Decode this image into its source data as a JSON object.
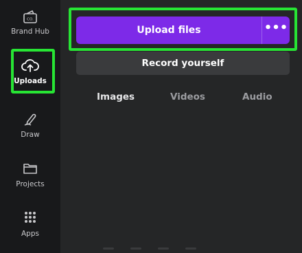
{
  "sidebar": {
    "items": [
      {
        "label": "Brand Hub",
        "icon": "brand-hub-icon"
      },
      {
        "label": "Uploads",
        "icon": "cloud-upload-icon",
        "active": true
      },
      {
        "label": "Draw",
        "icon": "draw-pen-icon"
      },
      {
        "label": "Projects",
        "icon": "folder-icon"
      },
      {
        "label": "Apps",
        "icon": "apps-grid-icon"
      }
    ]
  },
  "upload": {
    "upload_label": "Upload files",
    "more_label": "•••",
    "record_label": "Record yourself"
  },
  "tabs": [
    {
      "label": "Images",
      "active": true
    },
    {
      "label": "Videos"
    },
    {
      "label": "Audio"
    }
  ],
  "colors": {
    "accent": "#7d2ae8",
    "highlight": "#27e534",
    "rail_bg": "#18191b",
    "panel_bg": "#252627"
  }
}
